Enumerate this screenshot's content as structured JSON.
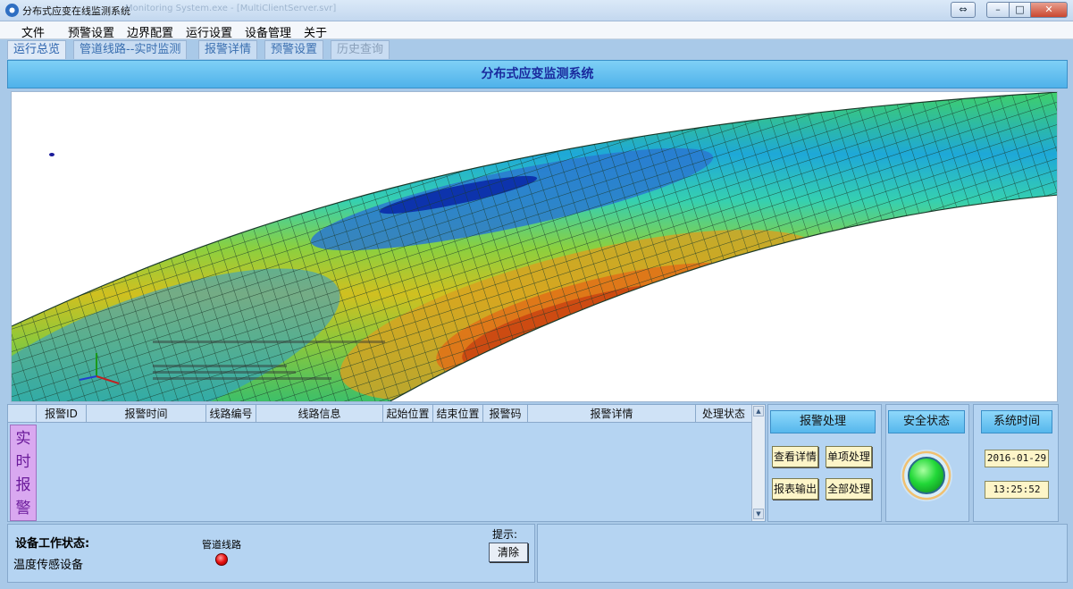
{
  "window": {
    "title": "分布式应变在线监测系统",
    "title_faded": "Monitoring System.exe - [MultiClientServer.svr]",
    "restore_glyph": "⇔",
    "min_glyph": "–",
    "max_glyph": "□",
    "close_glyph": "✕"
  },
  "menu": [
    "文件",
    "预警设置",
    "边界配置",
    "运行设置",
    "设备管理",
    "关于"
  ],
  "tabs": [
    {
      "label": "运行总览",
      "state": "active"
    },
    {
      "label": "管道线路--实时监测",
      "state": "normal"
    },
    {
      "label": "报警详情",
      "state": "normal"
    },
    {
      "label": "预警设置",
      "state": "normal"
    },
    {
      "label": "历史查询",
      "state": "disabled"
    }
  ],
  "banner": {
    "title": "分布式应变监测系统"
  },
  "alarm_table": {
    "columns": [
      "",
      "报警ID",
      "报警时间",
      "线路编号",
      "线路信息",
      "起始位置",
      "结束位置",
      "报警码",
      "报警详情",
      "处理状态"
    ],
    "side_label": [
      "实",
      "时",
      "报",
      "警"
    ],
    "rows": []
  },
  "alarm_actions": {
    "title": "报警处理",
    "view_details": "查看详情",
    "single_process": "单项处理",
    "report_export": "报表输出",
    "process_all": "全部处理"
  },
  "safety": {
    "title": "安全状态",
    "status_color": "#22d838"
  },
  "system_time": {
    "title": "系统时间",
    "date": "2016-01-29",
    "time": "13:25:52"
  },
  "device_status": {
    "title": "设备工作状态:",
    "device": "温度传感设备",
    "pipeline_label": "管道线路",
    "pipeline_status_color": "#e81010"
  },
  "hint": {
    "label": "提示:",
    "clear_button": "清除"
  }
}
